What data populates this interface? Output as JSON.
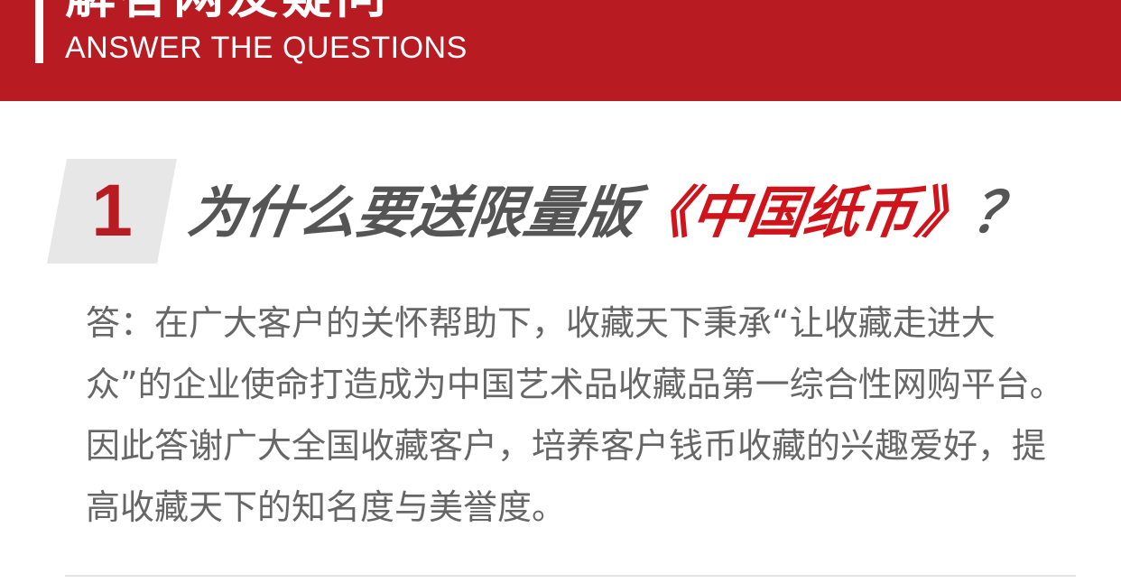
{
  "header": {
    "title_cn": "解答网友疑问",
    "title_en": "ANSWER THE QUESTIONS"
  },
  "question": {
    "number": "1",
    "text_before": "为什么要送限量版",
    "book_title": "《中国纸币》",
    "text_after": "？"
  },
  "answer": {
    "text": "答：在广大客户的关怀帮助下，收藏天下秉承“让收藏走进大众”的企业使命打造成为中国艺术品收藏品第一综合性网购平台。因此答谢广大全国收藏客户，培养客户钱币收藏的兴趣爱好，提高收藏天下的知名度与美誉度。"
  },
  "colors": {
    "brand_red": "#b81c22",
    "highlight_red": "#d0141c",
    "question_gray": "#555555",
    "body_gray": "#666666",
    "number_box_bg": "#e7e7e7"
  }
}
